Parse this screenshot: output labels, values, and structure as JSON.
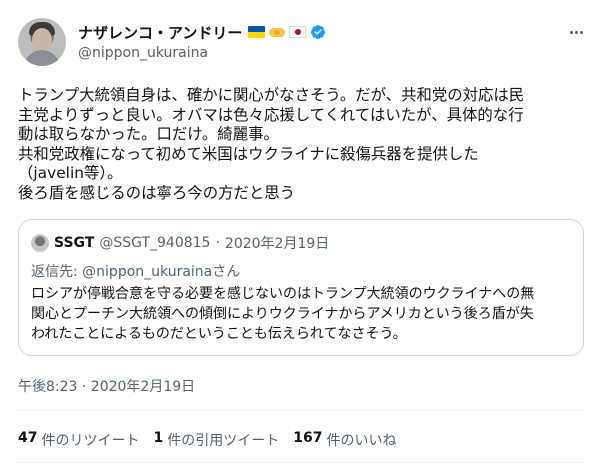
{
  "author": {
    "display_name": "ナザレンコ・アンドリー",
    "handle": "@nippon_ukuraina",
    "badges": [
      "ukraine-flag-icon",
      "handshake-icon",
      "japan-flag-icon",
      "verified-badge-icon"
    ]
  },
  "tweet": {
    "text_lines": [
      "トランプ大統領自身は、確かに関心がなさそう。だが、共和党の対応は民",
      "主党よりずっと良い。オバマは色々応援してくれてはいたが、具体的な行",
      "動は取らなかった。口だけ。綺麗事。",
      "共和党政権になって初めて米国はウクライナに殺傷兵器を提供した",
      "（javelin等）。",
      "後ろ盾を感じるのは寧ろ今の方だと思う"
    ],
    "timestamp": "午後8:23 · 2020年2月19日"
  },
  "quoted": {
    "name": "SSGT",
    "handle": "@SSGT_940815",
    "separator": "·",
    "date": "2020年2月19日",
    "reply_prefix": "返信先: ",
    "reply_to": "@nippon_ukurainaさん",
    "text_lines": [
      "ロシアが停戦合意を守る必要を感じないのはトランプ大統領のウクライナへの無",
      "関心とプーチン大統領への傾倒によりウクライナからアメリカという後ろ盾が失",
      "われたことによるものだということも伝えられてなさそう。"
    ]
  },
  "stats": {
    "retweets": {
      "count": "47",
      "label": "件のリツイート"
    },
    "quotes": {
      "count": "1",
      "label": "件の引用ツイート"
    },
    "likes": {
      "count": "167",
      "label": "件のいいね"
    }
  },
  "colors": {
    "text": "#0f1419",
    "secondary": "#536471",
    "border": "#cfd9de",
    "verified": "#1d9bf0"
  }
}
